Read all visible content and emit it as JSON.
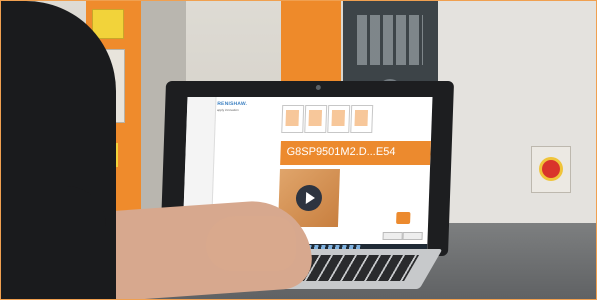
{
  "screen": {
    "brand": "RENISHAW.",
    "subtitle": "apply innovation",
    "top_right": "",
    "menu_items": [
      "",
      "",
      "",
      "",
      "",
      "",
      ""
    ],
    "part_code": "G8SP9501M2.D...E54",
    "buttons": [
      "",
      ""
    ]
  },
  "colors": {
    "accent": "#ec8a2e",
    "brand": "#3a7fc1"
  },
  "icons": [
    "play-icon",
    "webcam-icon"
  ]
}
